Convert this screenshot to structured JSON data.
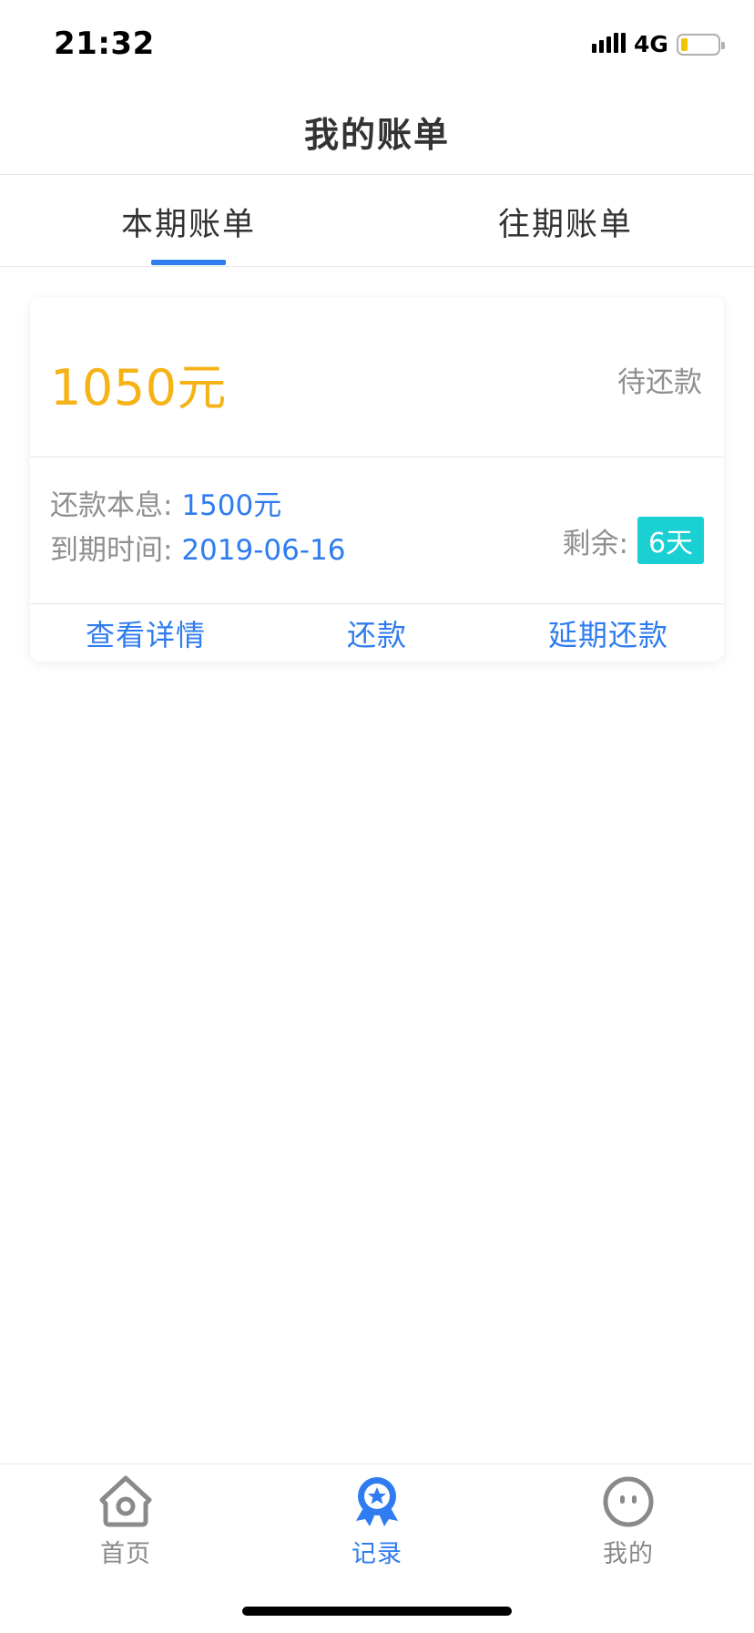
{
  "status_bar": {
    "time": "21:32",
    "network": "4G"
  },
  "header": {
    "title": "我的账单"
  },
  "tabs": [
    {
      "label": "本期账单",
      "active": true
    },
    {
      "label": "往期账单",
      "active": false
    }
  ],
  "bill": {
    "amount": "1050元",
    "status": "待还款",
    "principal_label": "还款本息: ",
    "principal_value": "1500元",
    "due_label": "到期时间: ",
    "due_value": "2019-06-16",
    "remain_label": "剩余:",
    "remain_value": "6天",
    "actions": {
      "details": "查看详情",
      "repay": "还款",
      "extend": "延期还款"
    }
  },
  "bottom_nav": [
    {
      "label": "首页",
      "icon": "home-icon",
      "active": false
    },
    {
      "label": "记录",
      "icon": "medal-icon",
      "active": true
    },
    {
      "label": "我的",
      "icon": "face-icon",
      "active": false
    }
  ],
  "colors": {
    "accent": "#2f7cf0",
    "amount": "#f5b317",
    "badge": "#1ad0d2",
    "muted": "#8f8f8f",
    "battery": "#f5c400"
  }
}
